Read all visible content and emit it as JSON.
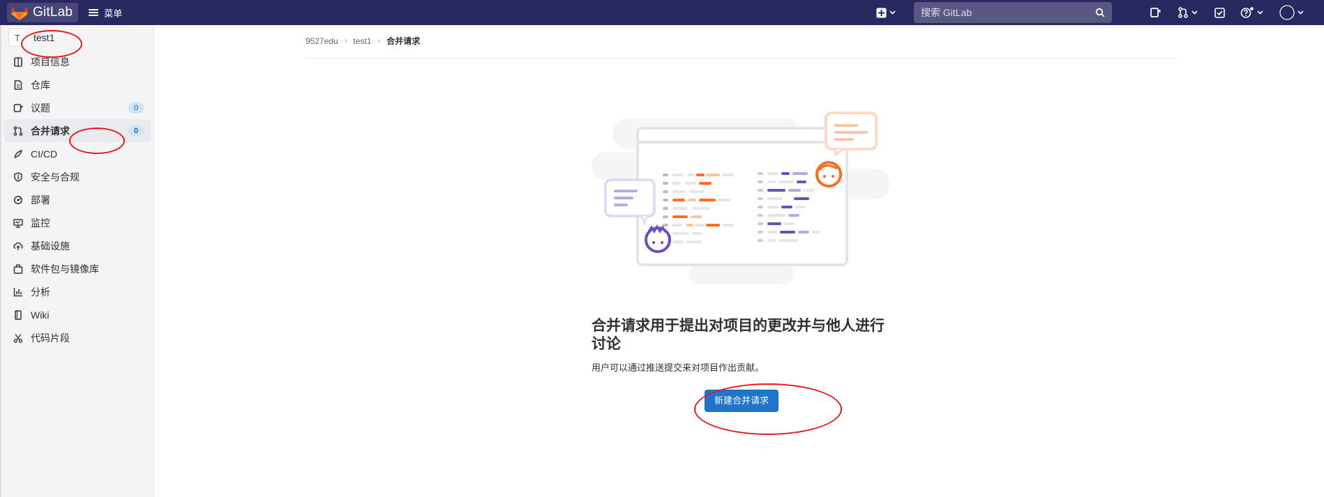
{
  "navbar": {
    "brand": "GitLab",
    "menu_label": "菜单",
    "search_placeholder": "搜索 GitLab"
  },
  "sidebar": {
    "project_initial": "T",
    "project_name": "test1",
    "items": [
      {
        "label": "项目信息",
        "icon": "project-info-icon"
      },
      {
        "label": "仓库",
        "icon": "repository-icon"
      },
      {
        "label": "议题",
        "icon": "issues-icon",
        "badge": "0"
      },
      {
        "label": "合并请求",
        "icon": "merge-request-icon",
        "badge": "0",
        "active": true
      },
      {
        "label": "CI/CD",
        "icon": "rocket-icon"
      },
      {
        "label": "安全与合规",
        "icon": "shield-icon"
      },
      {
        "label": "部署",
        "icon": "deployments-icon"
      },
      {
        "label": "监控",
        "icon": "monitor-icon"
      },
      {
        "label": "基础设施",
        "icon": "cloud-icon"
      },
      {
        "label": "软件包与镜像库",
        "icon": "package-icon"
      },
      {
        "label": "分析",
        "icon": "analytics-icon"
      },
      {
        "label": "Wiki",
        "icon": "book-icon"
      },
      {
        "label": "代码片段",
        "icon": "snippet-icon"
      }
    ]
  },
  "breadcrumb": [
    "9527edu",
    "test1",
    "合并请求"
  ],
  "empty_state": {
    "title": "合并请求用于提出对项目的更改并与他人进行讨论",
    "description": "用户可以通过推送提交来对项目作出贡献。",
    "button": "新建合并请求"
  },
  "colors": {
    "navbar": "#292961",
    "primary_button": "#1f75cb",
    "annotation": "#e41818",
    "illustration_orange": "#fc6d26",
    "illustration_purple": "#6b4fbb"
  }
}
